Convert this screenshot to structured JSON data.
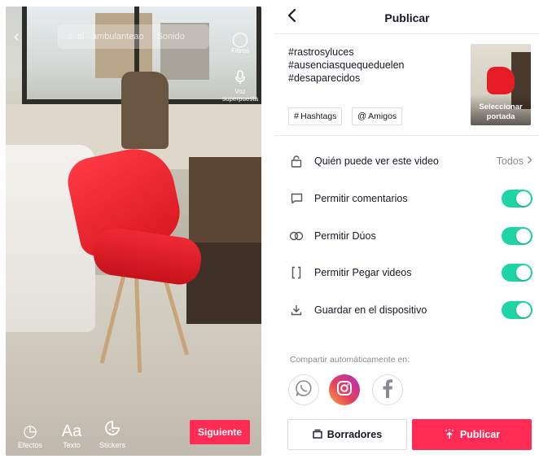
{
  "editor": {
    "sound_chip": {
      "song": "sl - ambulanteao",
      "sound_label": "Sonido"
    },
    "side_tools": [
      {
        "label": "Filtros",
        "icon": "filters-icon"
      },
      {
        "label": "Voz superpuesta",
        "icon": "microphone-icon"
      }
    ],
    "bottom_tools": [
      {
        "label": "Efectos",
        "icon": "effects-timer-icon"
      },
      {
        "label": "Texto",
        "icon": "text-aa-icon"
      },
      {
        "label": "Stickers",
        "icon": "sticker-icon"
      }
    ],
    "next_button": "Siguiente"
  },
  "publish": {
    "title": "Publicar",
    "caption": "#rastrosyluces #ausenciasquequeduelen #desaparecidos",
    "cover_label": "Seleccionar portada",
    "chips": {
      "hashtags": "Hashtags",
      "friends": "Amigos"
    },
    "settings": [
      {
        "label": "Quién puede ver este video",
        "value": "Todos",
        "icon": "lock-icon"
      },
      {
        "label": "Permitir comentarios",
        "toggle": true,
        "icon": "comment-icon"
      },
      {
        "label": "Permitir Dúos",
        "toggle": true,
        "icon": "duet-icon"
      },
      {
        "label": "Permitir Pegar videos",
        "toggle": true,
        "icon": "stitch-icon"
      },
      {
        "label": "Guardar en el dispositivo",
        "toggle": true,
        "icon": "download-icon"
      }
    ],
    "share_label": "Compartir automáticamente en:",
    "share_targets": [
      "whatsapp-icon",
      "instagram-icon",
      "facebook-icon"
    ],
    "drafts_button": "Borradores",
    "publish_button": "Publicar"
  },
  "colors": {
    "accent": "#fe2c55",
    "toggle_on": "#20d5a5",
    "text_primary": "#161823",
    "text_secondary": "#8a8b91"
  }
}
